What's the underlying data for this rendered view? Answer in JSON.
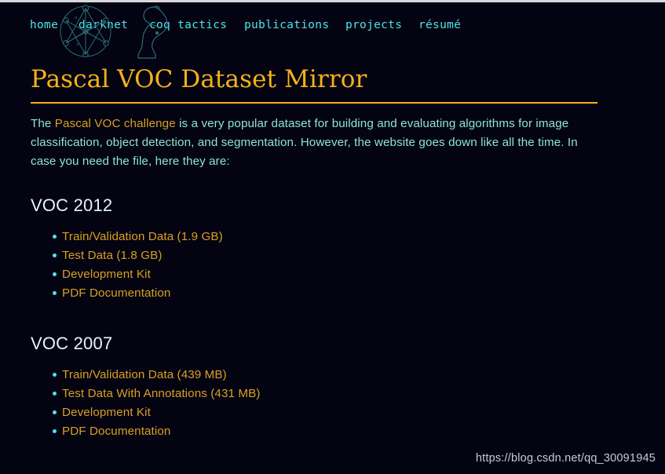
{
  "site": {
    "background_color": "#030312",
    "accent_color": "#f5b218",
    "link_color": "#d9a020",
    "nav_color": "#4fe3e8",
    "body_text_color": "#8fe3d8",
    "heading_color": "#e4f4ff"
  },
  "nav": {
    "items": [
      {
        "label": "home",
        "icon": ""
      },
      {
        "label": "darknet",
        "icon": "darknet-graph-logo"
      },
      {
        "label": "coq tactics",
        "icon": "coq-rooster-logo"
      },
      {
        "label": "publications",
        "icon": ""
      },
      {
        "label": "projects",
        "icon": ""
      },
      {
        "label": "résumé",
        "icon": ""
      }
    ]
  },
  "main": {
    "title": "Pascal VOC Dataset Mirror",
    "intro": {
      "before_link": "The ",
      "link_text": "Pascal VOC challenge",
      "after_link": " is a very popular dataset for building and evaluating algorithms for image classification, object detection, and segmentation. However, the website goes down like all the time. In case you need the file, here they are:"
    },
    "sections": [
      {
        "heading": "VOC 2012",
        "items": [
          {
            "label": "Train/Validation Data (1.9 GB)"
          },
          {
            "label": "Test Data (1.8 GB)"
          },
          {
            "label": "Development Kit"
          },
          {
            "label": "PDF Documentation"
          }
        ]
      },
      {
        "heading": "VOC 2007",
        "items": [
          {
            "label": "Train/Validation Data (439 MB)"
          },
          {
            "label": "Test Data With Annotations (431 MB)"
          },
          {
            "label": "Development Kit"
          },
          {
            "label": "PDF Documentation"
          }
        ]
      }
    ]
  },
  "watermark": {
    "text": "https://blog.csdn.net/qq_30091945"
  }
}
